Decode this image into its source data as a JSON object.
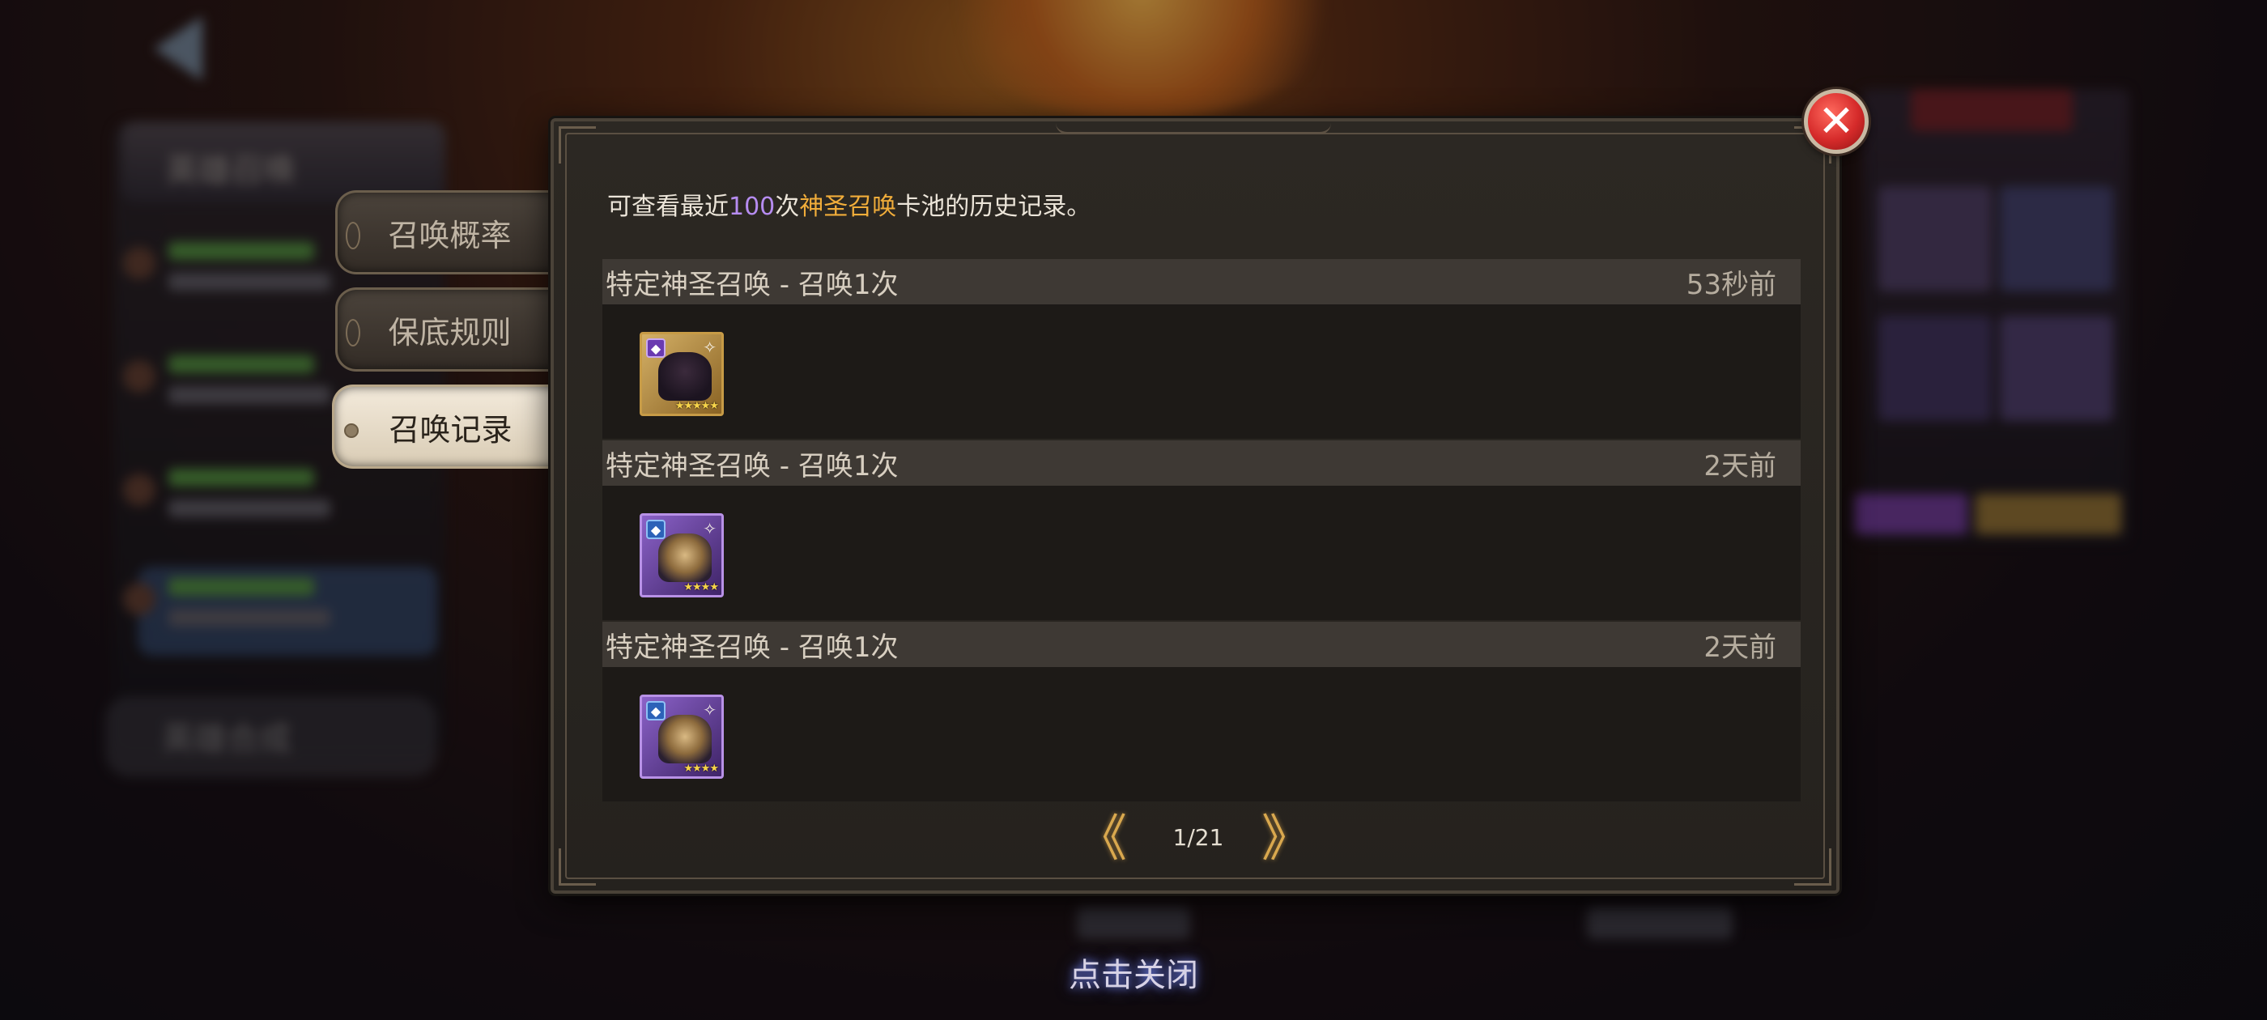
{
  "background": {
    "left_panel_title": "英雄召唤",
    "left_panel_footer": "英雄合成"
  },
  "side_tabs": [
    {
      "label": "召唤概率",
      "active": false
    },
    {
      "label": "保底规则",
      "active": false
    },
    {
      "label": "召唤记录",
      "active": true
    }
  ],
  "dialog": {
    "intro": {
      "prefix": "可查看最近",
      "count": "100",
      "middle": "次",
      "pool": "神圣召唤",
      "suffix": "卡池的历史记录。"
    },
    "records": [
      {
        "title": "特定神圣召唤 - 召唤1次",
        "time": "53秒前",
        "card": {
          "rarity": "gold",
          "stars": "★★★★★",
          "element_icon": "dark-element-icon",
          "class_icon": "wand-icon"
        }
      },
      {
        "title": "特定神圣召唤 - 召唤1次",
        "time": "2天前",
        "card": {
          "rarity": "purple",
          "stars": "★★★★",
          "element_icon": "water-element-icon",
          "class_icon": "wand-icon"
        }
      },
      {
        "title": "特定神圣召唤 - 召唤1次",
        "time": "2天前",
        "card": {
          "rarity": "purple",
          "stars": "★★★★",
          "element_icon": "water-element-icon",
          "class_icon": "wand-icon"
        }
      }
    ],
    "pagination": {
      "prev_symbol": "《",
      "text": "1/21",
      "next_symbol": "》"
    },
    "close_symbol": "✕"
  },
  "tap_to_close": "点击关闭",
  "colors": {
    "count_highlight": "#b68cf0",
    "pool_highlight": "#f1ad3a",
    "close_red": "#d52a2a",
    "pager_gold": "#d9a84e"
  }
}
